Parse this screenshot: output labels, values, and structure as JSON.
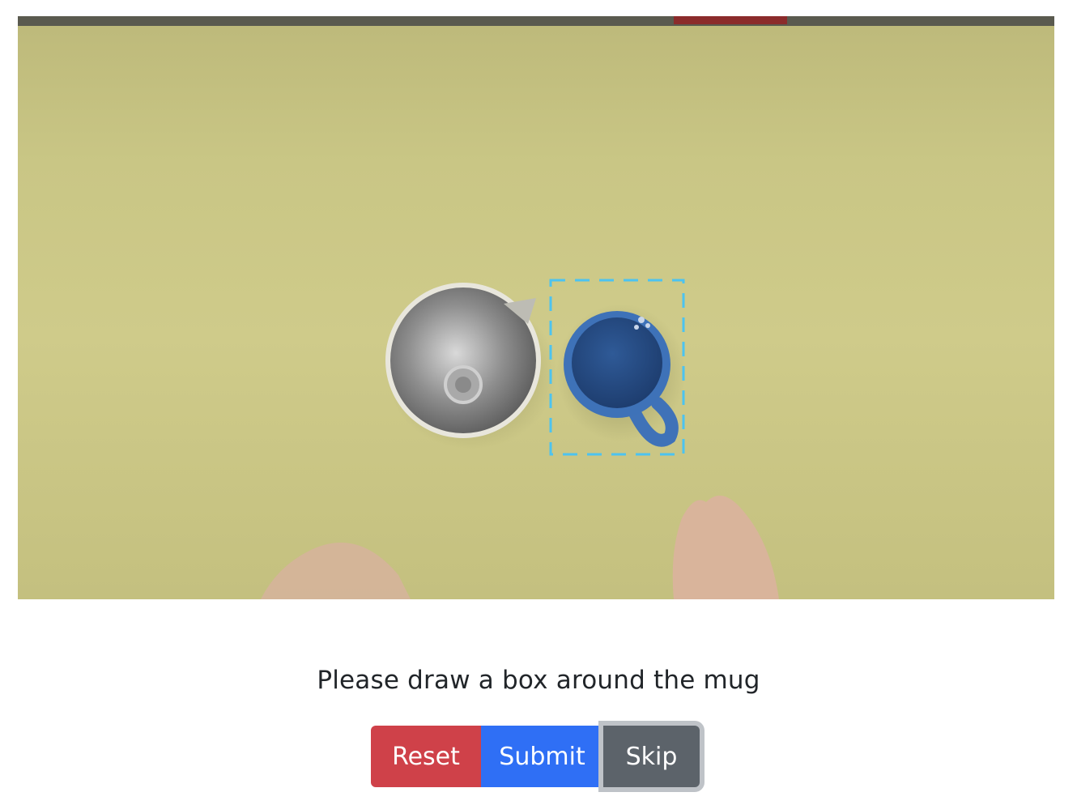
{
  "instruction": "Please draw a box around the mug",
  "buttons": {
    "reset": "Reset",
    "submit": "Submit",
    "skip": "Skip"
  },
  "colors": {
    "reset": "#cf4149",
    "submit": "#2f6ff5",
    "skip": "#5c636a",
    "selection_box": "#4cc3f0",
    "mug": "#3a6fb5",
    "table": "#cfcb8a"
  }
}
